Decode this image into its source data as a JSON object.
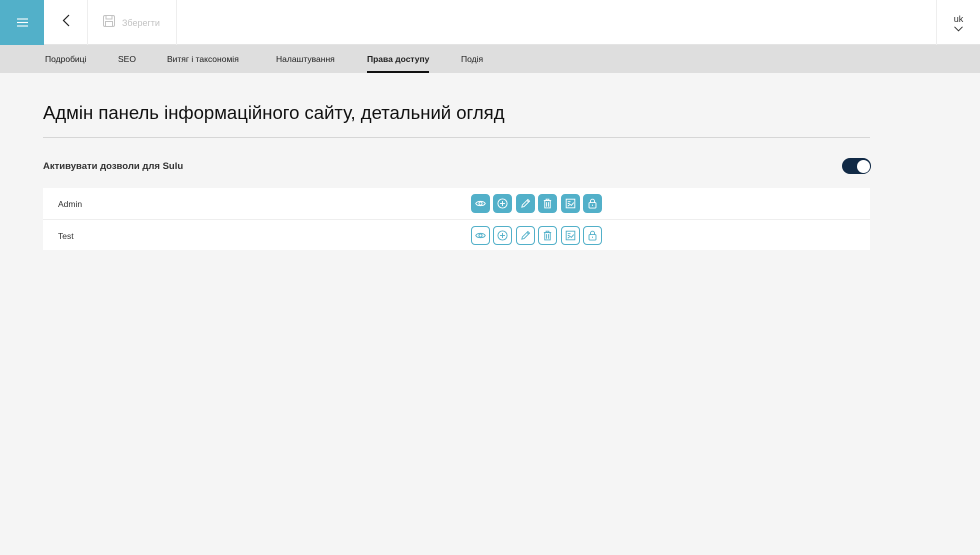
{
  "toolbar": {
    "save_label": "Зберегти",
    "locale": "uk"
  },
  "tabs": [
    {
      "label": "Подробиці"
    },
    {
      "label": "SEO"
    },
    {
      "label": "Витяг і таксономія"
    },
    {
      "label": "Налаштування"
    },
    {
      "label": "Права доступу",
      "active": true
    },
    {
      "label": "Подія"
    }
  ],
  "page": {
    "title": "Адмін панель інформаційного сайту, детальний огляд",
    "permissions_toggle_label": "Активувати дозволи для Sulu",
    "permissions_enabled": true
  },
  "roles": [
    {
      "name": "Admin",
      "permissions": {
        "view": true,
        "add": true,
        "edit": true,
        "delete": true,
        "live": true,
        "security": true
      }
    },
    {
      "name": "Test",
      "permissions": {
        "view": false,
        "add": false,
        "edit": false,
        "delete": false,
        "live": false,
        "security": false
      }
    }
  ],
  "icons": [
    "menu-icon",
    "chevron-left-icon",
    "floppy-disk-icon",
    "chevron-down-icon",
    "eye-icon",
    "plus-circle-icon",
    "pencil-icon",
    "trash-icon",
    "publish-icon",
    "lock-icon"
  ],
  "colors": {
    "accent": "#52b0c9",
    "toggle_on": "#112a46",
    "tabs_bg": "#dedede",
    "page_bg": "#f5f5f5"
  }
}
